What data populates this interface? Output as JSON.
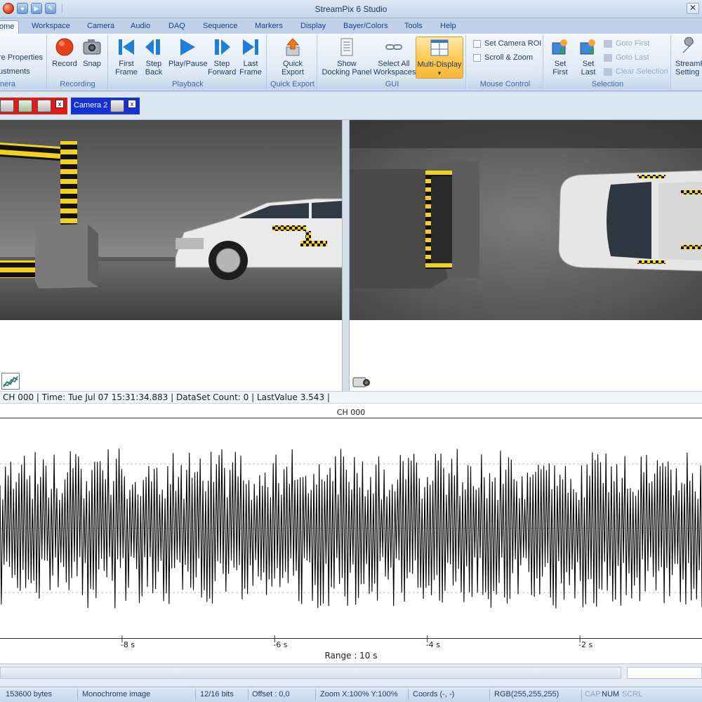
{
  "window": {
    "title": "StreamPix 6 Studio",
    "close_glyph": "✕"
  },
  "tabs": [
    {
      "label": "ome",
      "active": true
    },
    {
      "label": "Workspace"
    },
    {
      "label": "Camera"
    },
    {
      "label": "Audio"
    },
    {
      "label": "DAQ"
    },
    {
      "label": "Sequence"
    },
    {
      "label": "Markers"
    },
    {
      "label": "Display"
    },
    {
      "label": "Bayer/Colors"
    },
    {
      "label": "Tools"
    },
    {
      "label": "Help"
    }
  ],
  "ribbon": {
    "camera_group": {
      "label": "nera",
      "items": [
        "re Properties",
        "ustments"
      ]
    },
    "recording": {
      "label": "Recording",
      "record": "Record",
      "snap": "Snap"
    },
    "playback": {
      "label": "Playback",
      "first_frame": [
        "First",
        "Frame"
      ],
      "step_back": [
        "Step",
        "Back"
      ],
      "play_pause": "Play/Pause",
      "step_forward": [
        "Step",
        "Forward"
      ],
      "last_frame": [
        "Last",
        "Frame"
      ]
    },
    "quick_export": {
      "label": "Quick Export",
      "button": [
        "Quick",
        "Export"
      ]
    },
    "gui": {
      "label": "GUI",
      "show_docking": [
        "Show",
        "Docking Panel"
      ],
      "select_all": [
        "Select All",
        "Workspaces"
      ],
      "multi_display": "Multi-Display",
      "multi_arrow": "▾"
    },
    "mouse_control": {
      "label": "Mouse Control",
      "set_roi": "Set Camera ROI",
      "scroll_zoom": "Scroll & Zoom"
    },
    "selection": {
      "label": "Selection",
      "set_first": [
        "Set",
        "First"
      ],
      "set_last": [
        "Set",
        "Last"
      ],
      "goto_first": "Goto First",
      "goto_last": "Goto Last",
      "clear_selection": "Clear Selection"
    },
    "settings": {
      "button": [
        "StreamP",
        "Setting"
      ]
    }
  },
  "camera_tabs": {
    "camera2_label": "Camera 2",
    "close_glyph": "x"
  },
  "channel_status": "CH 000 | Time: Tue Jul 07 15:31:34.883 | DataSet Count: 0 | LastValue 3.543 |",
  "chart_data": {
    "type": "line",
    "title": "CH 000",
    "xlabel": "Range : 10 s",
    "x_ticks": [
      "-8 s",
      "-6 s",
      "-4 s",
      "-2 s"
    ],
    "x_range": [
      -9.6,
      -0.4
    ],
    "y_range": [
      -1.2,
      1.2
    ],
    "grid": "dotted horizontal",
    "series": [
      {
        "style": "black line, dense random signal",
        "samples": 520,
        "amplitude": 1.0
      }
    ]
  },
  "statusbar": {
    "size": "153600 bytes",
    "image_type": "Monochrome image",
    "bits": "12/16 bits",
    "offset": "Offset : 0,0",
    "zoom": "Zoom X:100%  Y:100%",
    "coords": "Coords (-, -)",
    "rgb": "RGB(255,255,255)",
    "cap": "CAP",
    "num": "NUM",
    "scrl": "SCRL"
  }
}
